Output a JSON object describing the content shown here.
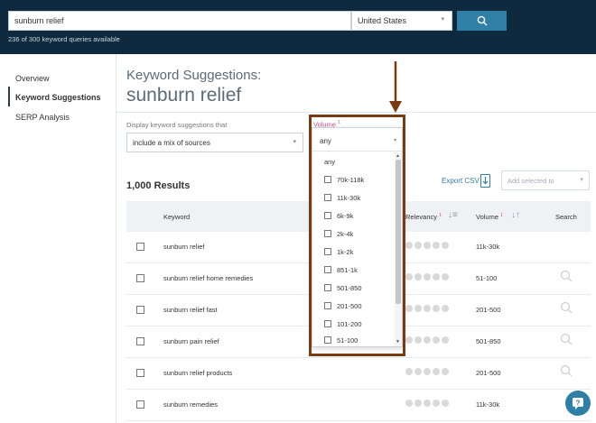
{
  "header": {
    "search_value": "sunburn relief",
    "country": "United States",
    "quota_text": "236 of 300 keyword queries available"
  },
  "sidebar": {
    "items": [
      {
        "label": "Overview"
      },
      {
        "label": "Keyword Suggestions"
      },
      {
        "label": "SERP Analysis"
      }
    ]
  },
  "main": {
    "title": "Keyword Suggestions:",
    "keyword": "sunburn relief",
    "filter_label": "Display keyword suggestions that",
    "sources_value": "include a mix of sources",
    "volume_label": "Volume",
    "volume_sup": "1",
    "results_count": "1,000 Results",
    "export_label": "Export CSV",
    "add_selected_placeholder": "Add selected to"
  },
  "table": {
    "headers": {
      "keyword": "Keyword",
      "relevancy": "Relevancy",
      "relevancy_sup": "1",
      "volume": "Volume",
      "volume_sup": "1",
      "search": "Search"
    },
    "rows": [
      {
        "keyword": "sunburn relief",
        "volume": "11k-30k"
      },
      {
        "keyword": "sunburn relief home remedies",
        "volume": "51-100"
      },
      {
        "keyword": "sunburn relief fast",
        "volume": "201-500"
      },
      {
        "keyword": "sunburn pain relief",
        "volume": "501-850"
      },
      {
        "keyword": "sunburn relief products",
        "volume": "201-500"
      },
      {
        "keyword": "sunburn remedies",
        "volume": "11k-30k"
      }
    ]
  },
  "volume_dropdown": {
    "selected": "any",
    "options": [
      "any",
      "70k-118k",
      "11k-30k",
      "6k-9k",
      "2k-4k",
      "1k-2k",
      "851-1k",
      "501-850",
      "201-500",
      "101-200",
      "51-100"
    ]
  },
  "colors": {
    "header_bg": "#0f2a3f",
    "accent_blue": "#2f7fa6",
    "annotation": "#7a3a12"
  }
}
